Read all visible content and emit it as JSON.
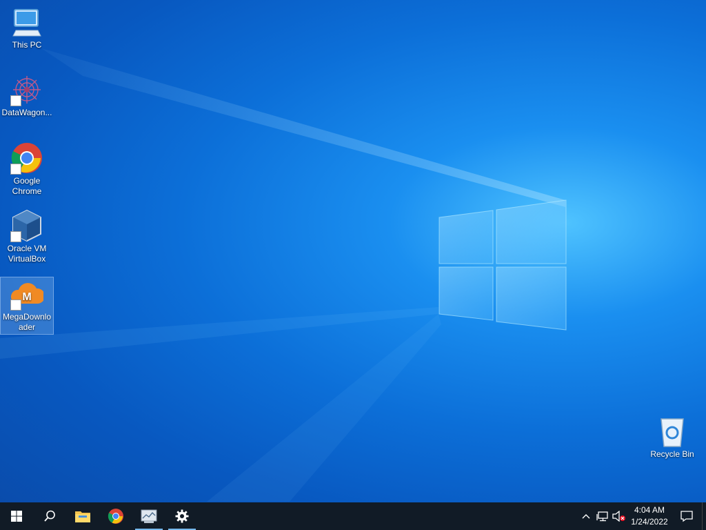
{
  "desktop": {
    "icons": [
      {
        "label": "This PC",
        "icon": "computer-icon"
      },
      {
        "label": "DataWagon...",
        "icon": "datawagon-icon"
      },
      {
        "label": "Google Chrome",
        "icon": "chrome-icon"
      },
      {
        "label": "Oracle VM VirtualBox",
        "icon": "virtualbox-icon"
      },
      {
        "label": "MegaDownloader",
        "icon": "megadownloader-icon"
      }
    ],
    "recycle_bin": {
      "label": "Recycle Bin",
      "icon": "recycle-bin-icon"
    }
  },
  "taskbar": {
    "buttons": [
      {
        "name": "start",
        "icon": "windows-logo-icon"
      },
      {
        "name": "search",
        "icon": "search-icon"
      },
      {
        "name": "file-explorer",
        "icon": "folder-icon"
      },
      {
        "name": "chrome",
        "icon": "chrome-icon"
      },
      {
        "name": "pinned-app",
        "icon": "app-window-icon"
      },
      {
        "name": "settings",
        "icon": "gear-icon"
      }
    ],
    "tray": {
      "icons": [
        "chevron-up-icon",
        "network-icon",
        "volume-muted-icon"
      ],
      "time": "4:04 AM",
      "date": "1/24/2022",
      "notification_icon": "action-center-icon"
    }
  },
  "colors": {
    "taskbar": "#111b26",
    "accent": "#76b9ed",
    "chrome_red": "#db4437",
    "chrome_yellow": "#f4c20d",
    "chrome_green": "#0f9d58",
    "chrome_blue": "#4285f4",
    "mega_orange": "#f08a24"
  }
}
